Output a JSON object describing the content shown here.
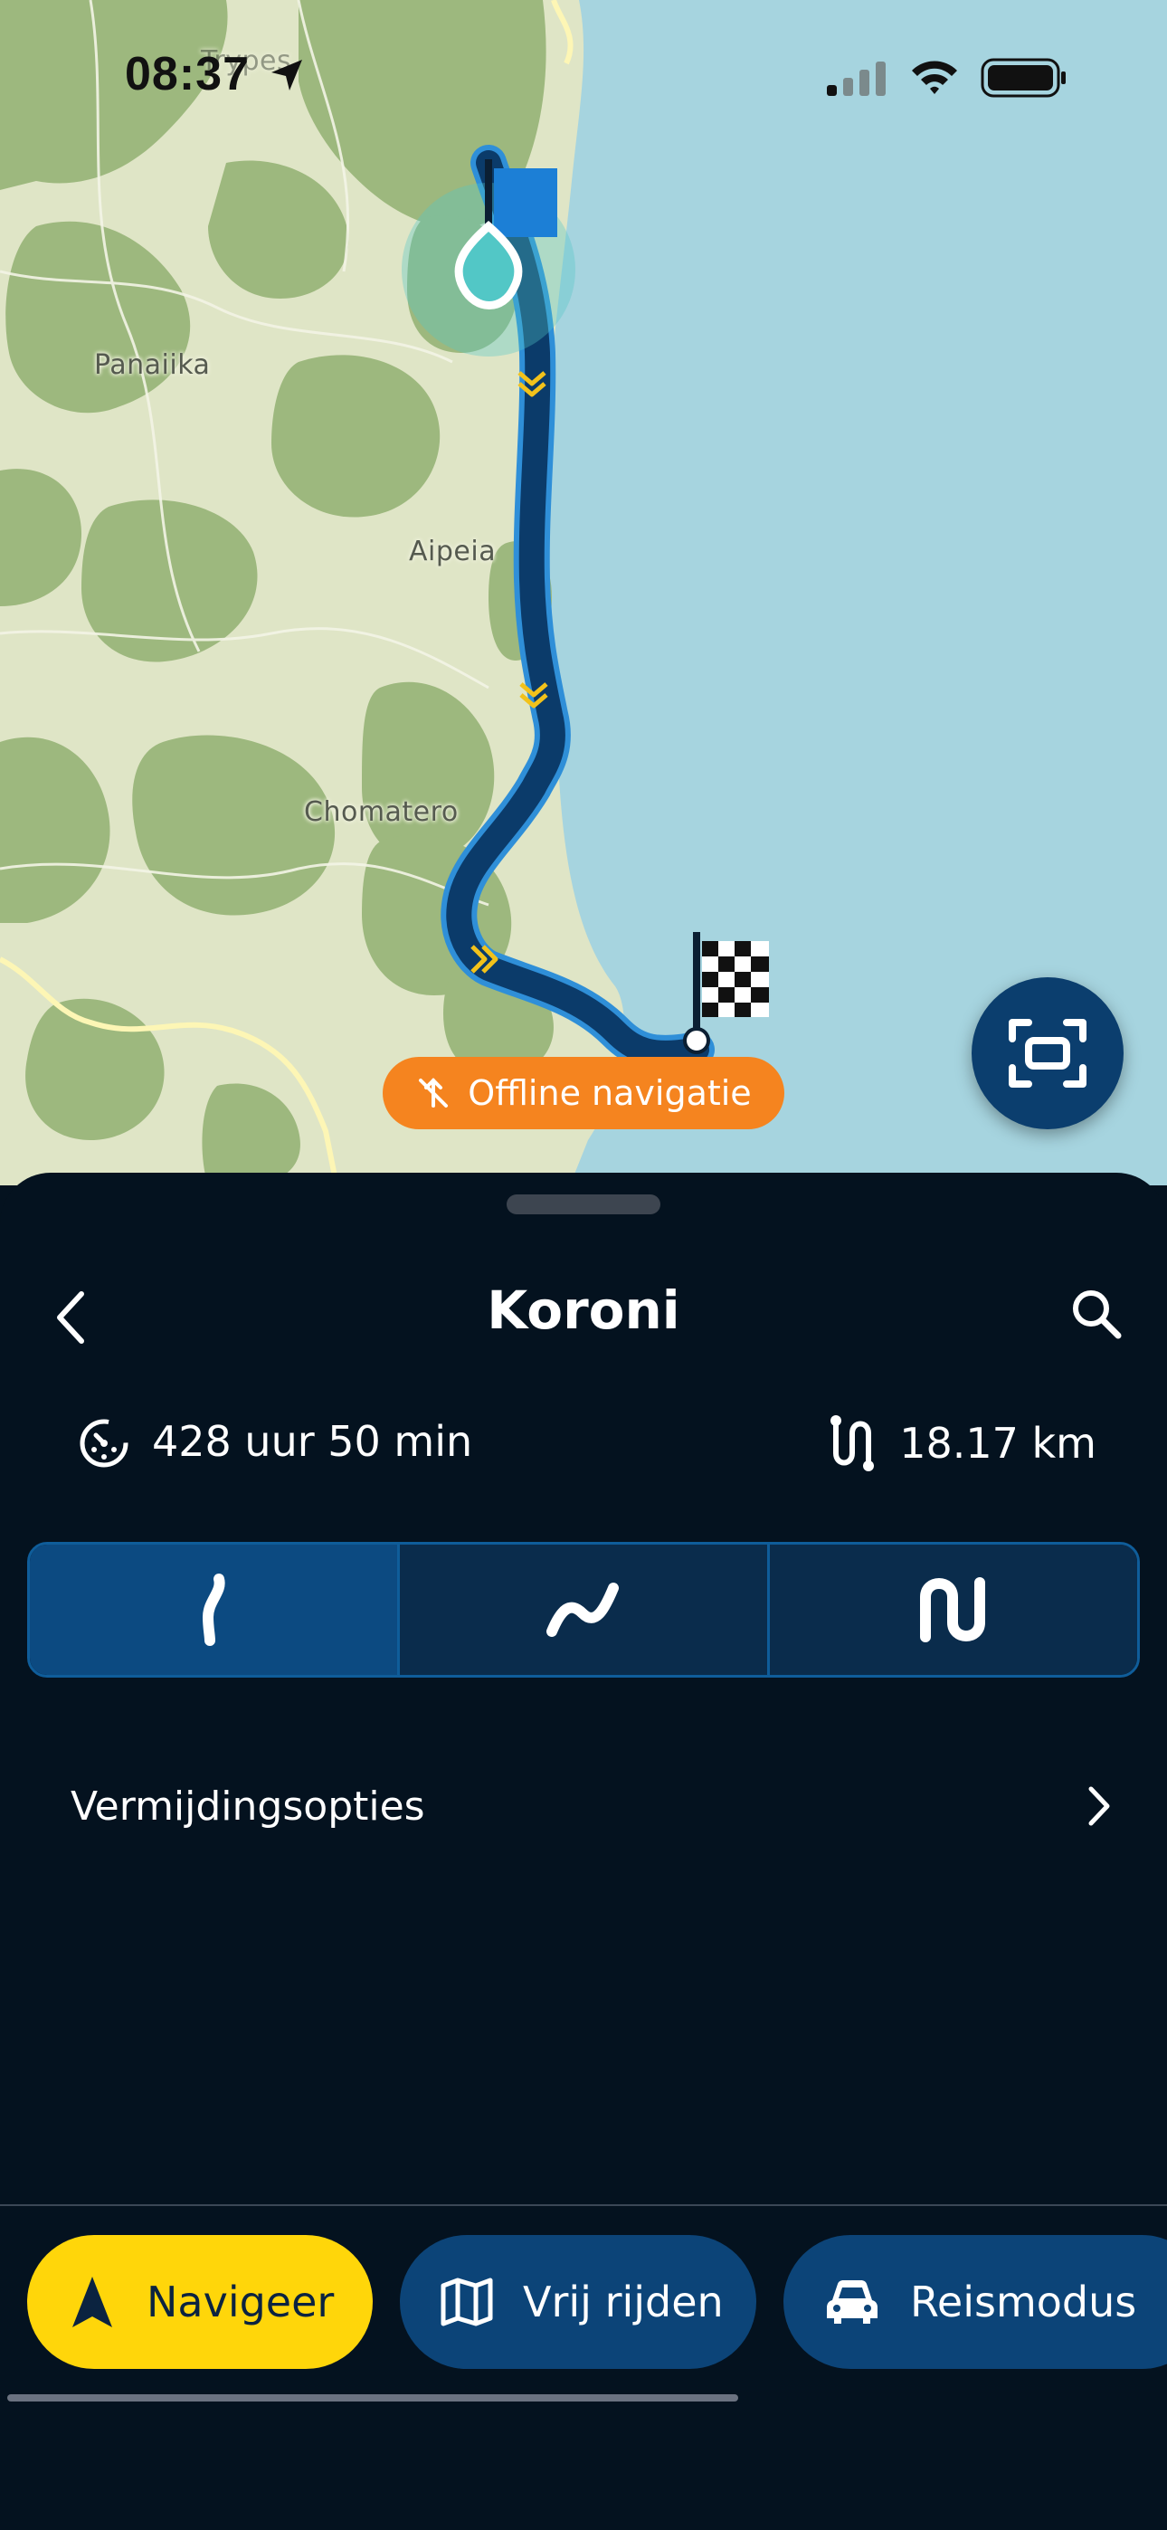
{
  "status_bar": {
    "time": "08:37",
    "icons": [
      "location-arrow-icon",
      "signal-icon",
      "wifi-icon",
      "battery-icon"
    ]
  },
  "map": {
    "place_labels": [
      "Trypes",
      "Panaiika",
      "Aipeia",
      "Chomatero"
    ],
    "offline_badge": "Offline navigatie",
    "colors": {
      "water": "#a6d4df",
      "land": "#dfe5c6",
      "forest": "#9db87e",
      "route": "#0b4a80",
      "route_outline": "#2f8fd8"
    }
  },
  "sheet": {
    "title": "Koroni",
    "duration": "428 uur 50 min",
    "distance": "18.17 km",
    "route_types": [
      {
        "icon": "route-straight-icon",
        "selected": true
      },
      {
        "icon": "route-curvy-icon",
        "selected": false
      },
      {
        "icon": "route-winding-icon",
        "selected": false
      }
    ],
    "avoid_options_label": "Vermijdingsopties"
  },
  "bottom_nav": {
    "navigate": "Navigeer",
    "free_drive": "Vrij rijden",
    "travel_mode": "Reismodus"
  },
  "colors": {
    "accent_yellow": "#ffd60a",
    "nav_blue": "#0c4478",
    "offline_orange": "#f5841f",
    "sheet_bg": "#04121f"
  }
}
